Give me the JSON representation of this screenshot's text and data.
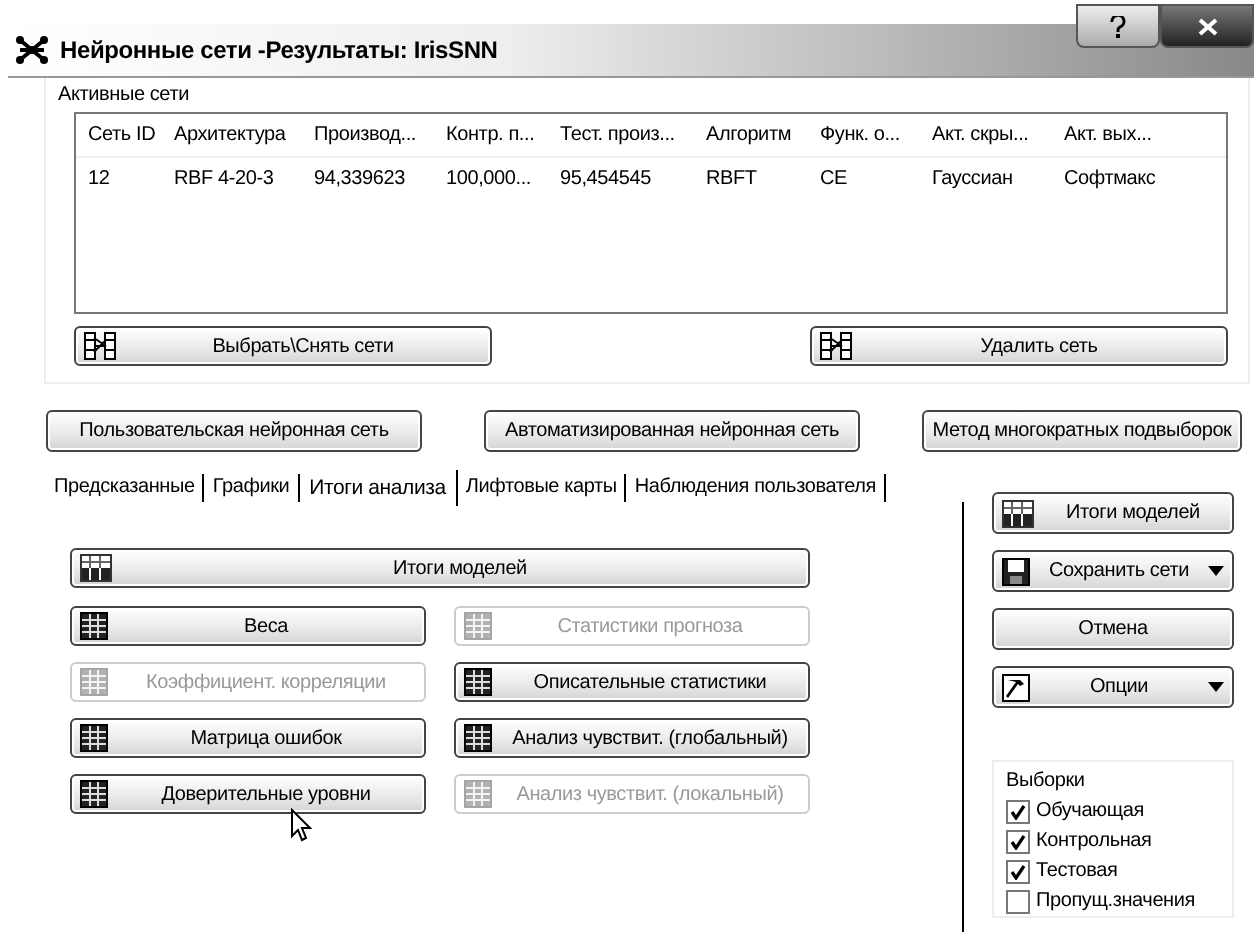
{
  "window": {
    "title": "Нейронные сети -Результаты: IrisSNN"
  },
  "active_networks": {
    "label": "Активные сети",
    "columns": [
      "Сеть ID",
      "Архитектура",
      "Производ...",
      "Контр. п...",
      "Тест. произ...",
      "Алгоритм",
      "Функ. о...",
      "Акт. скры...",
      "Акт. вых..."
    ],
    "rows": [
      [
        "12",
        "RBF 4-20-3",
        "94,339623",
        "100,000...",
        "95,454545",
        "RBFT",
        "CE",
        "Гауссиан",
        "Софтмакс"
      ]
    ]
  },
  "network_buttons": [
    "Выбрать\\Снять сети",
    "Удалить сеть"
  ],
  "mode_buttons": [
    "Пользовательская нейронная сеть",
    "Автоматизированная нейронная сеть",
    "Метод многократных подвыборок"
  ],
  "tabs": [
    {
      "label": "Предсказанные",
      "selected": false
    },
    {
      "label": "Графики",
      "selected": false
    },
    {
      "label": "Итоги анализа",
      "selected": true
    },
    {
      "label": "Лифтовые карты",
      "selected": false
    },
    {
      "label": "Наблюдения пользователя",
      "selected": false
    }
  ],
  "summary_button": "Итоги моделей",
  "result_buttons": [
    {
      "label": "Веса",
      "disabled": false
    },
    {
      "label": "Статистики прогноза",
      "disabled": true
    },
    {
      "label": "Коэффициент. корреляции",
      "disabled": true
    },
    {
      "label": "Описательные статистики",
      "disabled": false
    },
    {
      "label": "Матрица ошибок",
      "disabled": false
    },
    {
      "label": "Анализ чувствит. (глобальный)",
      "disabled": false
    },
    {
      "label": "Доверительные уровни",
      "disabled": false
    },
    {
      "label": "Анализ чувствит. (локальный)",
      "disabled": true
    }
  ],
  "side_buttons": [
    {
      "label": "Итоги моделей",
      "dropdown": false
    },
    {
      "label": "Сохранить сети",
      "dropdown": true
    },
    {
      "label": "Отмена",
      "dropdown": false
    },
    {
      "label": "Опции",
      "dropdown": true
    }
  ],
  "samples": {
    "label": "Выборки",
    "items": [
      {
        "label": "Обучающая",
        "checked": true
      },
      {
        "label": "Контрольная",
        "checked": true
      },
      {
        "label": "Тестовая",
        "checked": true
      },
      {
        "label": "Пропущ.значения",
        "checked": false
      }
    ]
  }
}
